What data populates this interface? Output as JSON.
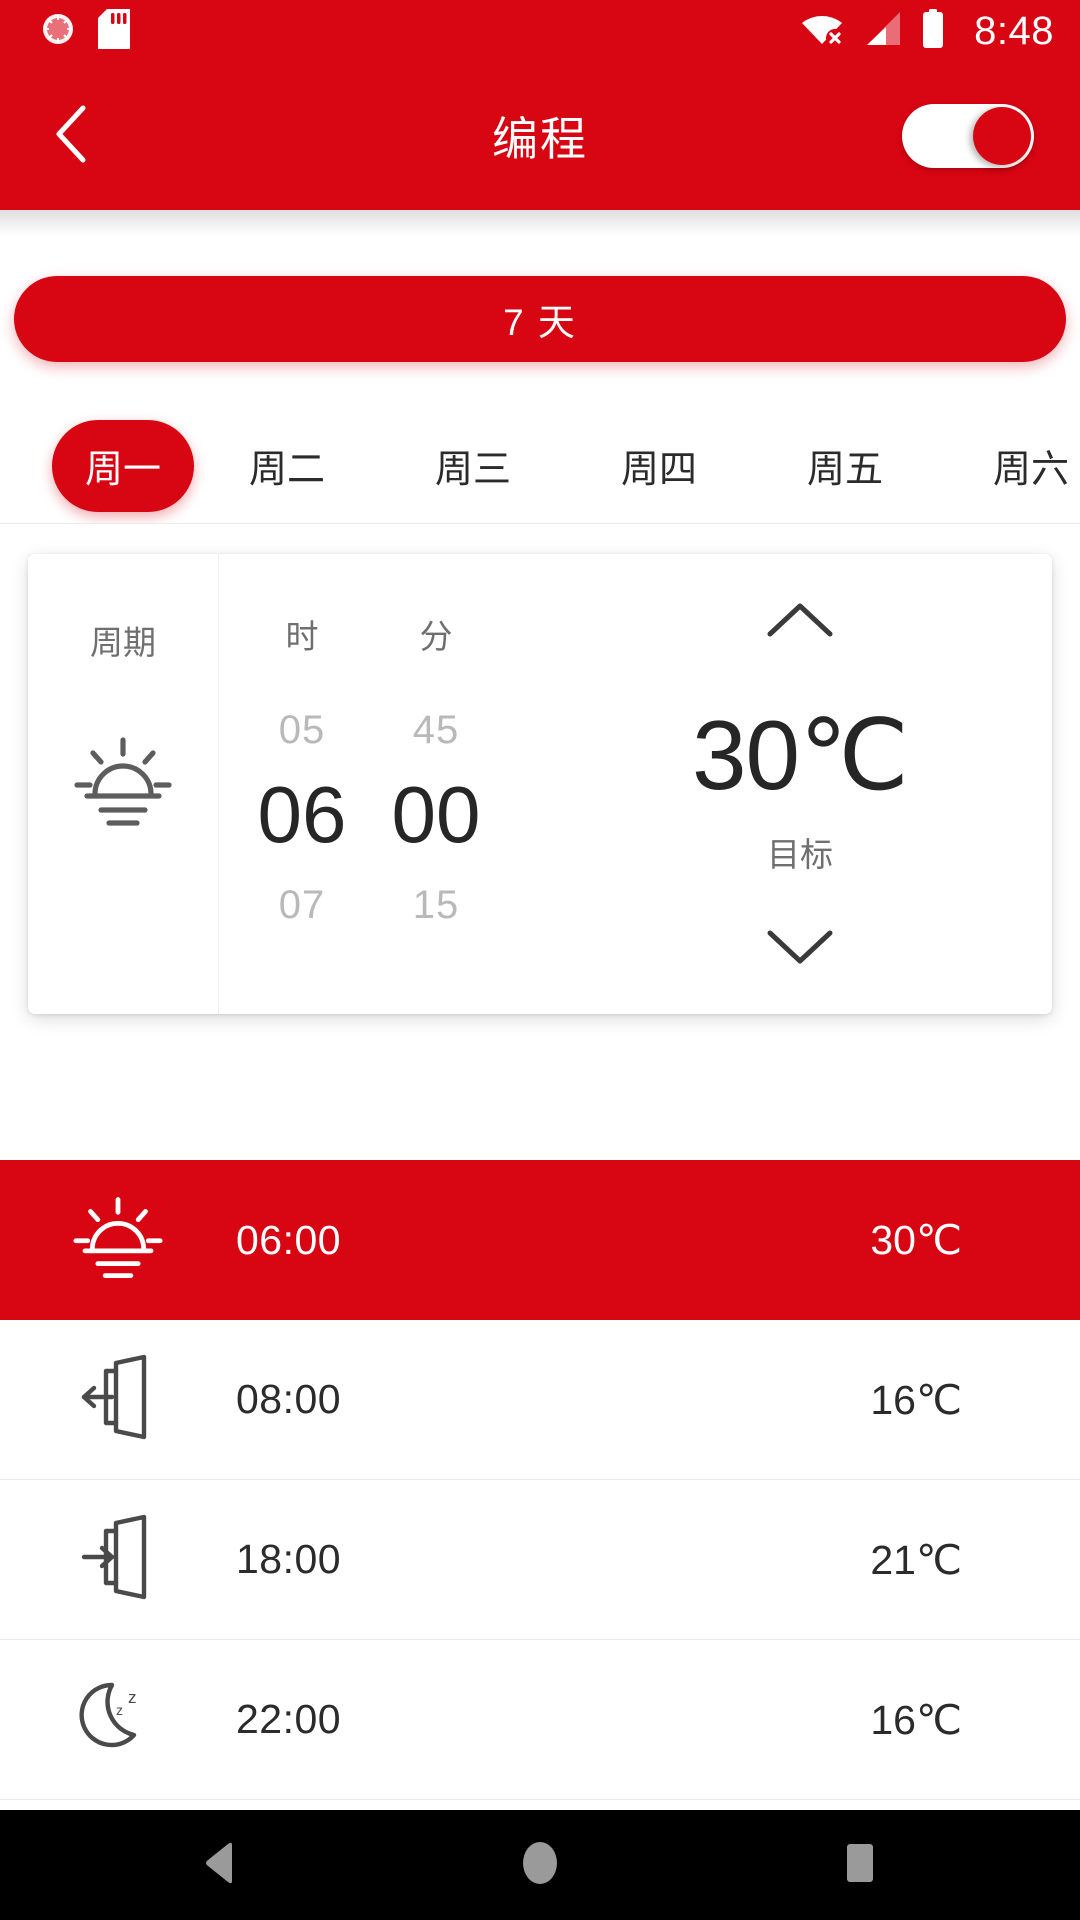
{
  "statusbar": {
    "time": "8:48",
    "icons": [
      "vibrate-ring-icon",
      "sd-card-icon",
      "wifi-off-icon",
      "cellular-signal-icon",
      "battery-full-icon"
    ]
  },
  "appbar": {
    "back_icon": "chevron-left-icon",
    "title": "编程",
    "toggle": {
      "name": "program-enable-switch",
      "state": "on"
    }
  },
  "days_button": {
    "label": "7 天"
  },
  "weekday_tabs": {
    "selected_index": 0,
    "items": [
      {
        "label": "周一"
      },
      {
        "label": "周二"
      },
      {
        "label": "周三"
      },
      {
        "label": "周四"
      },
      {
        "label": "周五"
      },
      {
        "label": "周六"
      }
    ]
  },
  "picker": {
    "period": {
      "label": "周期",
      "icon": "sunrise-icon"
    },
    "hour": {
      "label": "时",
      "prev": "05",
      "current": "06",
      "next": "07"
    },
    "minute": {
      "label": "分",
      "prev": "45",
      "current": "00",
      "next": "15"
    },
    "temperature": {
      "up_icon": "chevron-up-icon",
      "down_icon": "chevron-down-icon",
      "value": "30℃",
      "label": "目标"
    }
  },
  "schedule": {
    "rows": [
      {
        "icon": "sunrise-icon",
        "time": "06:00",
        "temp": "30℃",
        "selected": true
      },
      {
        "icon": "leave-home-icon",
        "time": "08:00",
        "temp": "16℃",
        "selected": false
      },
      {
        "icon": "enter-home-icon",
        "time": "18:00",
        "temp": "21℃",
        "selected": false
      },
      {
        "icon": "moon-sleep-icon",
        "time": "22:00",
        "temp": "16℃",
        "selected": false
      }
    ]
  },
  "navbar": {
    "back": "back-triangle-icon",
    "home": "home-circle-icon",
    "recents": "recents-square-icon"
  },
  "colors": {
    "brand_red": "#D80513",
    "text_primary": "#262626",
    "text_secondary": "#6f6f6f",
    "text_muted": "#b9b9b9",
    "divider": "#eceaea",
    "nav_background": "#000000"
  }
}
